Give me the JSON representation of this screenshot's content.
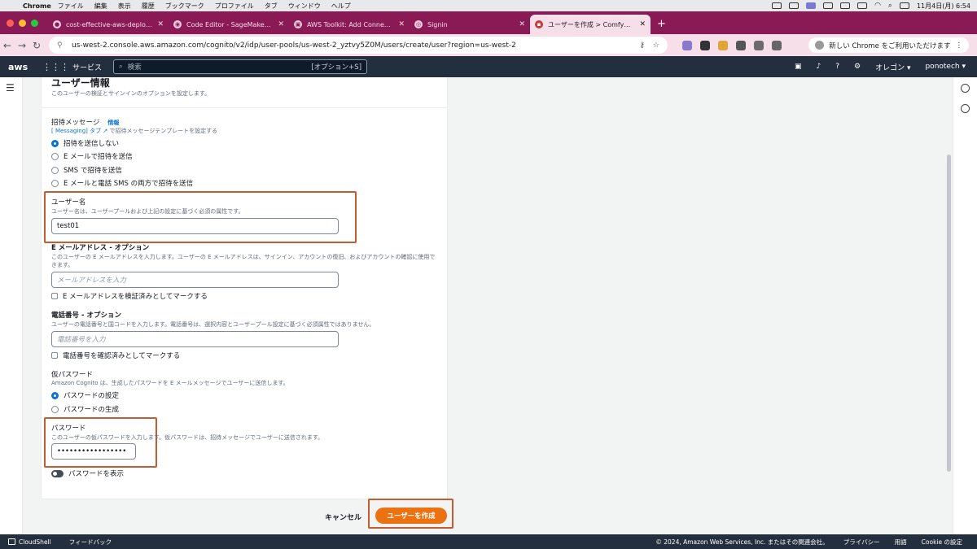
{
  "menubar": {
    "app": "Chrome",
    "items": [
      "ファイル",
      "編集",
      "表示",
      "履歴",
      "ブックマーク",
      "プロファイル",
      "タブ",
      "ウィンドウ",
      "ヘルプ"
    ],
    "datetime": "11月4日(月) 6:54"
  },
  "tabs": [
    {
      "title": "cost-effective-aws-deployme",
      "active": false
    },
    {
      "title": "Code Editor - SageMaker Stu",
      "active": false
    },
    {
      "title": "AWS Toolkit: Add Connection",
      "active": false
    },
    {
      "title": "Signin",
      "active": false
    },
    {
      "title": "ユーザーを作成 > ComfyUIuse",
      "active": true
    }
  ],
  "address": {
    "url": "us-west-2.console.aws.amazon.com/cognito/v2/idp/user-pools/us-west-2_yztvy5Z0M/users/create/user?region=us-west-2",
    "extension_badge": "12",
    "chrome_button": "新しい Chrome をご利用いただけます"
  },
  "aws_header": {
    "logo": "aws",
    "services": "サービス",
    "search_placeholder": "検索",
    "search_shortcut": "[オプション+S]",
    "region": "オレゴン ▾",
    "account": "ponotech ▾"
  },
  "section": {
    "title": "ユーザー情報",
    "description": "このユーザーの検証とサインインのオプションを設定します。"
  },
  "invitation": {
    "label": "招待メッセージ",
    "info": "情報",
    "desc_prefix": "[ Messaging] タブ",
    "desc_suffix": " で招待メッセージテンプレートを設定する",
    "options": [
      "招待を送信しない",
      "E メールで招待を送信",
      "SMS で招待を送信",
      "E メールと電話 SMS の両方で招待を送信"
    ],
    "selected_index": 0
  },
  "username": {
    "label": "ユーザー名",
    "desc": "ユーザー名は、ユーザープールおよび上記の設定に基づく必須の属性です。",
    "value": "test01"
  },
  "email": {
    "label": "E メールアドレス - オプション",
    "desc": "このユーザーの E メールアドレスを入力します。ユーザーの E メールアドレスは、サインイン、アカウントの復旧、およびアカウントの確認に使用できます。",
    "placeholder": "メールアドレスを入力",
    "verify_label": "E メールアドレスを検証済みとしてマークする"
  },
  "phone": {
    "label": "電話番号 - オプション",
    "desc": "ユーザーの電話番号と国コードを入力します。電話番号は、選択内容とユーザープール設定に基づく必須属性ではありません。",
    "placeholder": "電話番号を入力",
    "verify_label": "電話番号を確認済みとしてマークする"
  },
  "temp_password": {
    "label": "仮パスワード",
    "desc": "Amazon Cognito は、生成したパスワードを E メールメッセージでユーザーに送信します。",
    "options": [
      "パスワードの設定",
      "パスワードの生成"
    ],
    "selected_index": 0
  },
  "password": {
    "label": "パスワード",
    "desc": "このユーザーの仮パスワードを入力します。仮パスワードは、招待メッセージでユーザーに送信されます。",
    "value": "•••••••••••••••••",
    "show_label": "パスワードを表示"
  },
  "actions": {
    "cancel": "キャンセル",
    "create": "ユーザーを作成"
  },
  "footer": {
    "cloudshell": "CloudShell",
    "feedback": "フィードバック",
    "copyright": "© 2024, Amazon Web Services, Inc. またはその関連会社。",
    "privacy": "プライバシー",
    "terms": "用語",
    "cookie": "Cookie の設定"
  },
  "colors": {
    "tabstrip": "#8a1a55",
    "aws_header": "#232f3e",
    "primary_button": "#ec7211",
    "highlight_box": "#c65a31",
    "link": "#0972d3"
  }
}
